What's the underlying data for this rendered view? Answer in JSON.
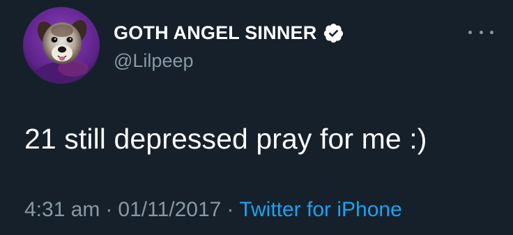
{
  "tweet": {
    "display_name": "GOTH ANGEL SINNER",
    "handle": "@Lilpeep",
    "verified_icon": "verified-badge-icon",
    "more_icon": "more-options-icon",
    "avatar_icon": "dog-avatar",
    "text": "21 still depressed pray for me :)",
    "time": "4:31 am",
    "date": "01/11/2017",
    "separator": "·",
    "source": "Twitter for iPhone"
  },
  "colors": {
    "background": "#15202b",
    "text_primary": "#ffffff",
    "text_muted": "#8899a6",
    "link": "#1da1f2",
    "avatar_purple": "#6a2a9c"
  }
}
